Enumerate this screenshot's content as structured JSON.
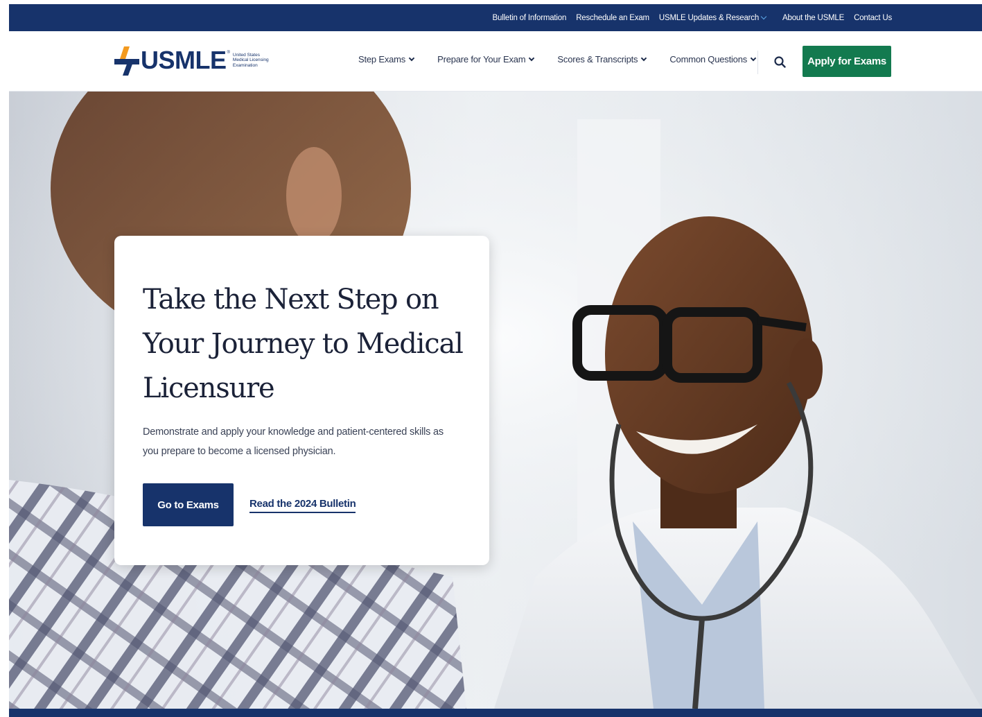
{
  "utility_nav": {
    "items": [
      {
        "label": "Bulletin of Information"
      },
      {
        "label": "Reschedule an Exam"
      },
      {
        "label": "USMLE Updates & Research",
        "has_dropdown": true
      },
      {
        "label": "About the USMLE"
      },
      {
        "label": "Contact Us"
      }
    ]
  },
  "header": {
    "logo": {
      "wordmark": "USMLE",
      "trademark": "®",
      "subtitle": "United States Medical Licensing Examination"
    },
    "nav": [
      {
        "label": "Step Exams"
      },
      {
        "label": "Prepare for Your Exam"
      },
      {
        "label": "Scores & Transcripts"
      },
      {
        "label": "Common Questions"
      }
    ],
    "search_icon": "search-icon",
    "apply_label": "Apply for Exams"
  },
  "hero": {
    "title": "Take the Next Step on Your Journey to Medical Licensure",
    "description": "Demonstrate and apply your knowledge and patient-centered skills as you prepare to become a licensed physician.",
    "primary_cta": "Go to Exams",
    "secondary_cta": "Read the 2024 Bulletin"
  },
  "colors": {
    "navy": "#17336b",
    "green": "#137a4f",
    "logo_orange": "#f39a1f"
  }
}
